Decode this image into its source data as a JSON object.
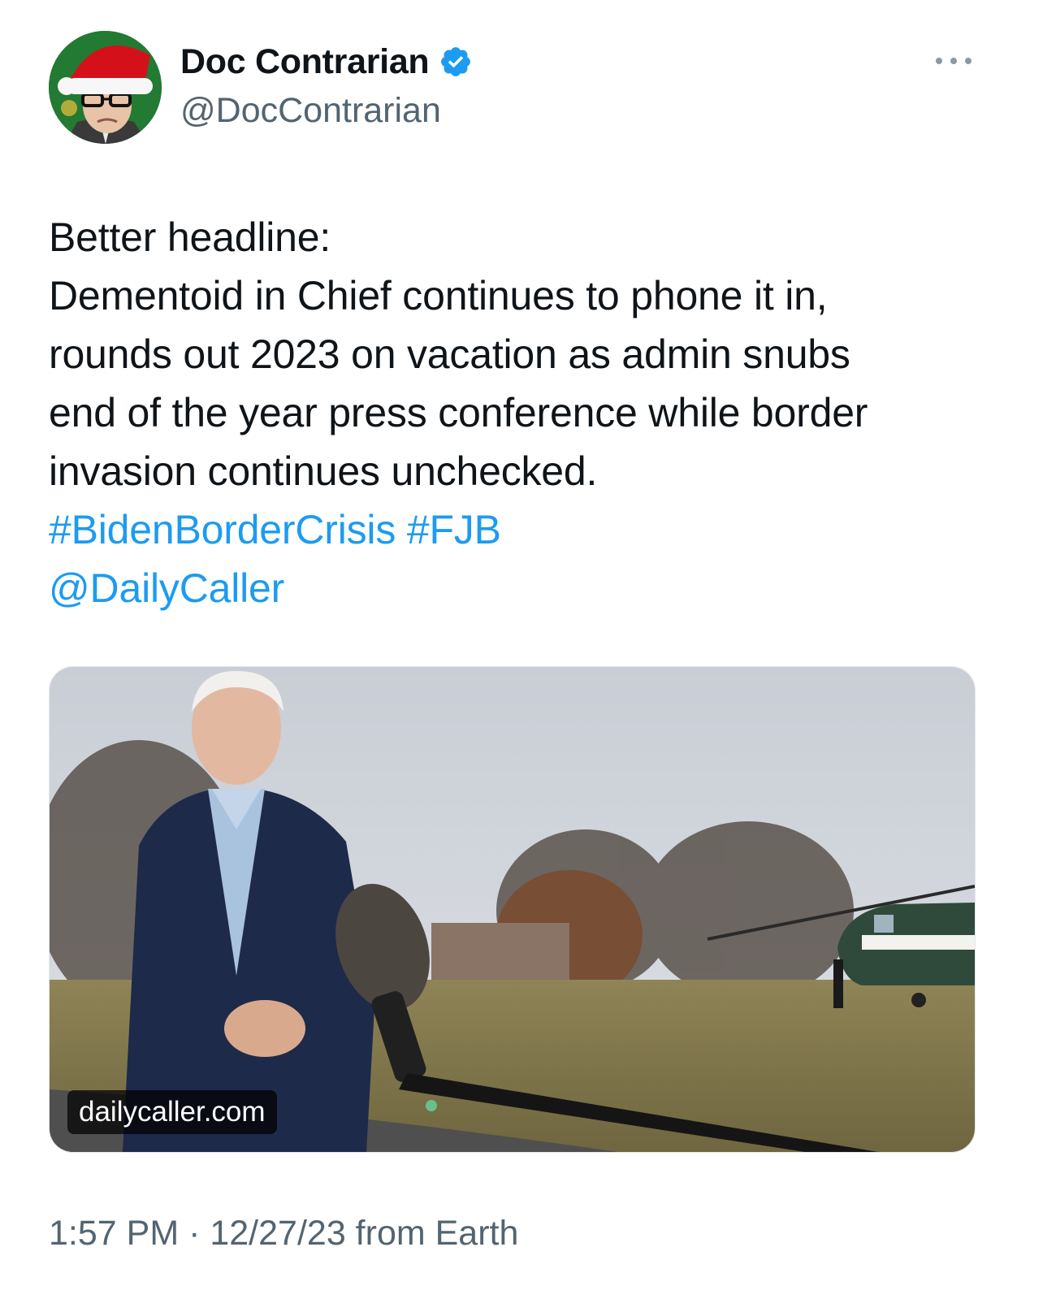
{
  "author": {
    "display_name": "Doc Contrarian",
    "handle": "@DocContrarian",
    "verified": true,
    "avatar_icon": "avatar-santa-hat-man"
  },
  "menu_icon": "more-dots-icon",
  "tweet": {
    "lines": [
      "Better headline:",
      "Dementoid in Chief continues to phone it in,",
      "rounds out 2023 on vacation as admin snubs",
      "end of the year press conference while border",
      "invasion continues unchecked."
    ],
    "hashtags": [
      "#BidenBorderCrisis",
      "#FJB"
    ],
    "mention": "@DailyCaller"
  },
  "link_card": {
    "domain": "dailycaller.com",
    "image_description_icon": "news-photo"
  },
  "meta": {
    "time": "1:57 PM",
    "date": "12/27/23",
    "source": "from Earth",
    "line": "1:57 PM · 12/27/23 from Earth"
  },
  "colors": {
    "link": "#1d9bf0",
    "verified_badge": "#1d9bf0",
    "secondary_text": "#536471",
    "primary_text": "#0f1419"
  }
}
